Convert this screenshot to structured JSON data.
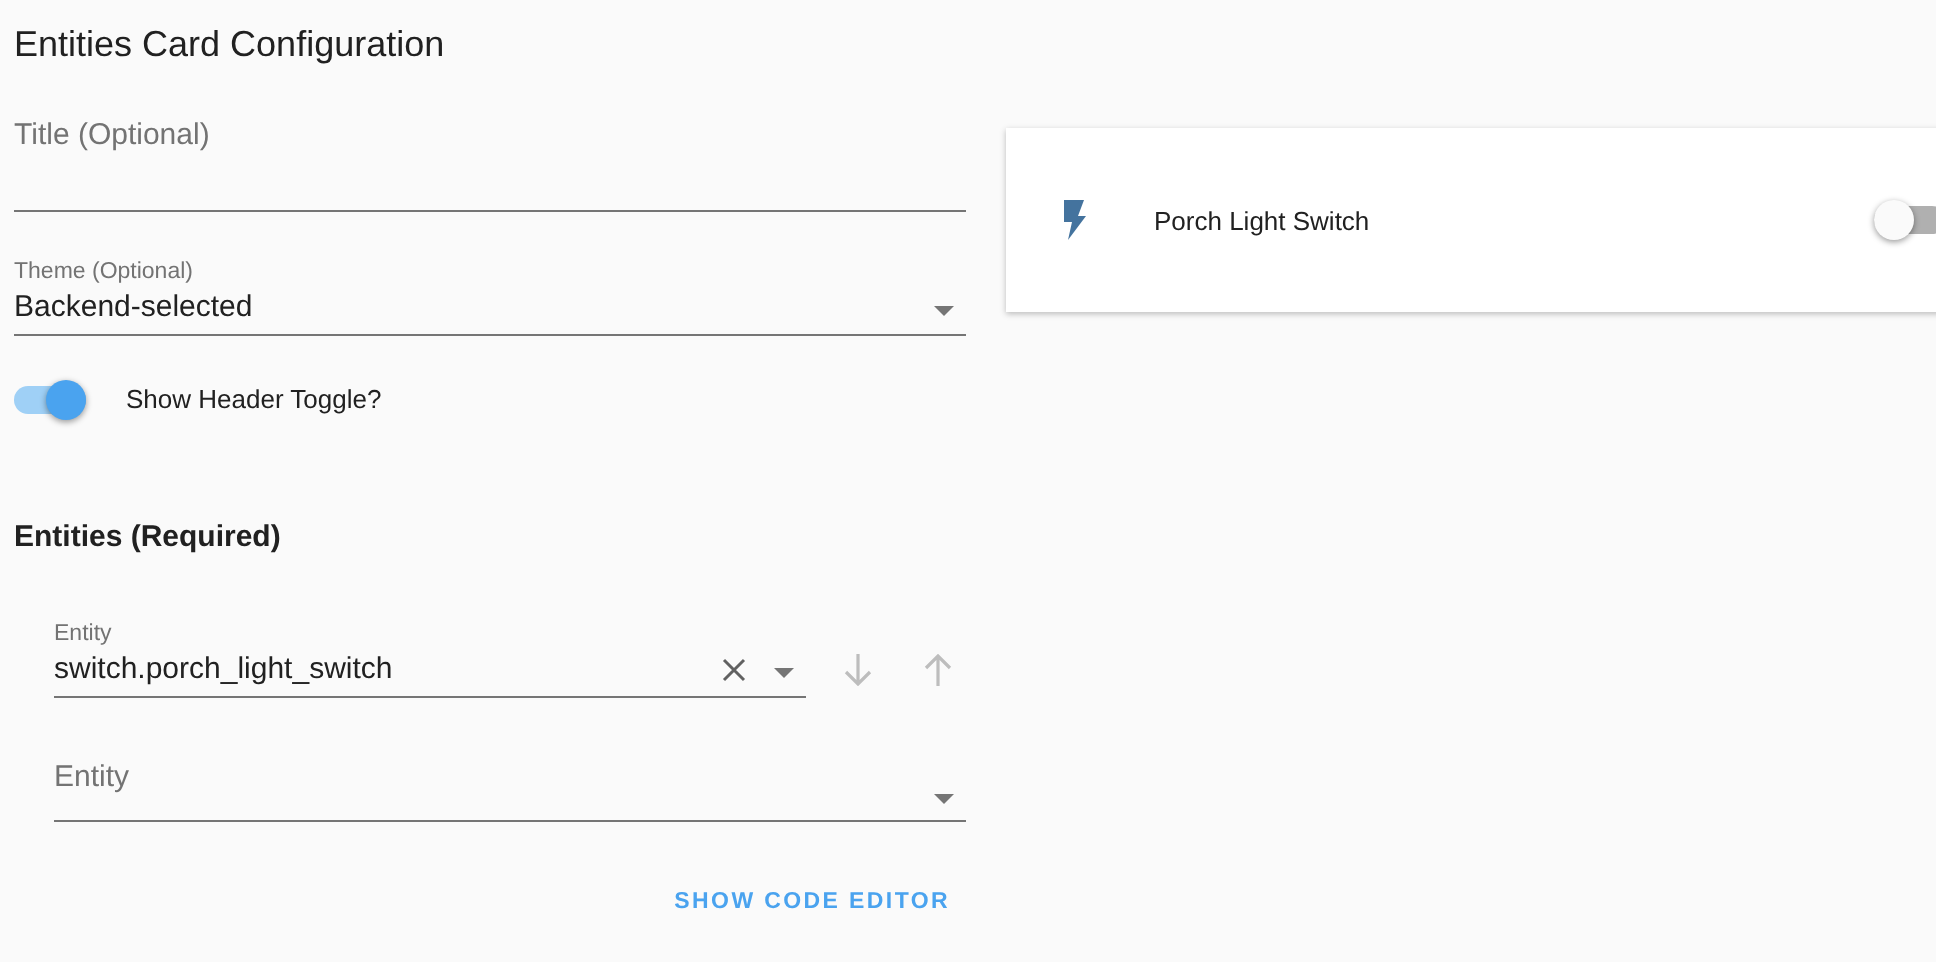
{
  "page": {
    "title": "Entities Card Configuration"
  },
  "title_field": {
    "placeholder": "Title (Optional)"
  },
  "theme_field": {
    "label": "Theme (Optional)",
    "value": "Backend-selected"
  },
  "header_toggle": {
    "label": "Show Header Toggle?",
    "on": true
  },
  "entities": {
    "heading": "Entities (Required)",
    "rows": [
      {
        "label": "Entity",
        "value": "switch.porch_light_switch",
        "kind": "filled"
      },
      {
        "placeholder": "Entity",
        "kind": "empty"
      }
    ]
  },
  "code_editor_button": "SHOW CODE EDITOR",
  "preview": {
    "rows": [
      {
        "name": "Porch Light Switch",
        "on": false
      }
    ]
  }
}
